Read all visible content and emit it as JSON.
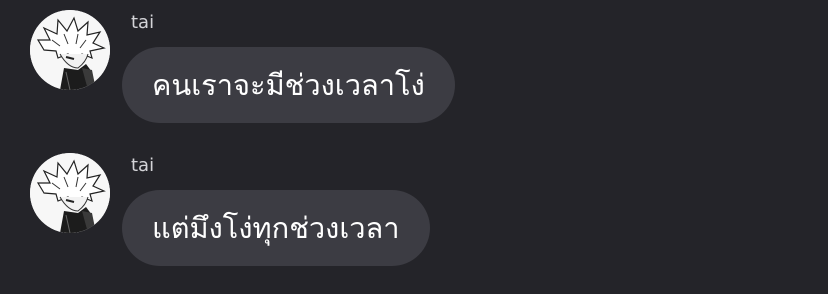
{
  "conversation": {
    "messages": [
      {
        "sender": "tai",
        "avatar_icon": "anime-character-avatar",
        "text": "คนเราจะมีช่วงเวลาโง่"
      },
      {
        "sender": "tai",
        "avatar_icon": "anime-character-avatar",
        "text": "แต่มึงโง่ทุกช่วงเวลา"
      }
    ]
  },
  "colors": {
    "background": "#242429",
    "bubble": "#3c3c43",
    "message_text": "#ffffff",
    "sender_text": "#d4d4d8"
  }
}
